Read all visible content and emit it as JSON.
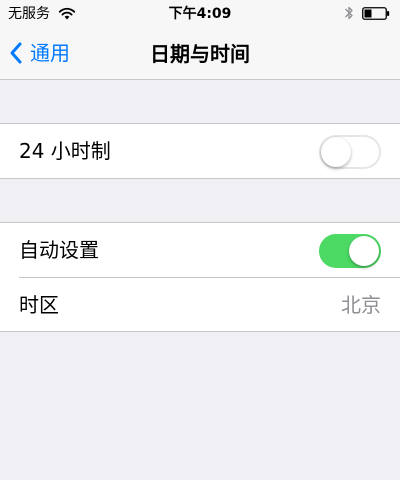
{
  "status_bar": {
    "carrier": "无服务",
    "time": "下午4:09",
    "icons": [
      "wifi-icon",
      "bluetooth-icon",
      "battery-icon"
    ]
  },
  "nav": {
    "back_label": "通用",
    "title": "日期与时间",
    "accent_color": "#007aff"
  },
  "sections": [
    {
      "rows": [
        {
          "label": "24 小时制",
          "control": "toggle",
          "value": false
        }
      ]
    },
    {
      "rows": [
        {
          "label": "自动设置",
          "control": "toggle",
          "value": true
        },
        {
          "label": "时区",
          "control": "detail",
          "value": "北京"
        }
      ]
    }
  ],
  "colors": {
    "background": "#efeff4",
    "toggle_on": "#4cd964",
    "detail_text": "#8e8e93"
  }
}
